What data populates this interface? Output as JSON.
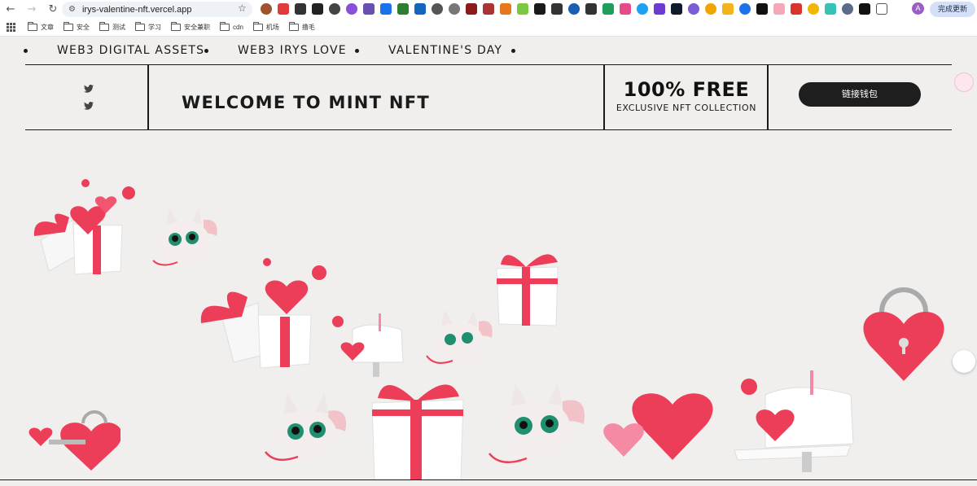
{
  "browser": {
    "url": "irys-valentine-nft.vercel.app",
    "profile_initial": "A",
    "update_label": "完成更新",
    "bookmarks": [
      "文章",
      "安全",
      "测试",
      "学习",
      "安全兼职",
      "cdn",
      "机场",
      "撸毛"
    ]
  },
  "site": {
    "marquee": [
      "WEB3 DIGITAL ASSETS",
      "WEB3 IRYS LOVE",
      "VALENTINE'S DAY"
    ],
    "welcome_title": "WELCOME TO MINT NFT",
    "free_title": "100% FREE",
    "free_subtitle": "EXCLUSIVE NFT COLLECTION",
    "connect_wallet": "链接钱包"
  },
  "colors": {
    "background": "#f0efed",
    "ink": "#1a1a1a",
    "heart_red": "#ec3d59",
    "heart_pink": "#f58aa4",
    "gift_white": "#ffffff",
    "button_dark": "#1e1e1e"
  },
  "icons": [
    "back-icon",
    "forward-icon",
    "reload-icon",
    "site-info-icon",
    "star-icon",
    "twitter-icon",
    "apps-icon",
    "folder-icon"
  ]
}
